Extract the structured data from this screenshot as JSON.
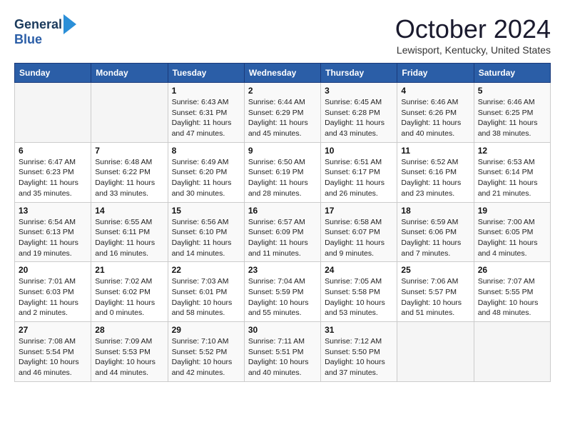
{
  "header": {
    "logo_line1": "General",
    "logo_line2": "Blue",
    "month_title": "October 2024",
    "location": "Lewisport, Kentucky, United States"
  },
  "days_of_week": [
    "Sunday",
    "Monday",
    "Tuesday",
    "Wednesday",
    "Thursday",
    "Friday",
    "Saturday"
  ],
  "weeks": [
    [
      {
        "num": "",
        "info": ""
      },
      {
        "num": "",
        "info": ""
      },
      {
        "num": "1",
        "info": "Sunrise: 6:43 AM\nSunset: 6:31 PM\nDaylight: 11 hours and 47 minutes."
      },
      {
        "num": "2",
        "info": "Sunrise: 6:44 AM\nSunset: 6:29 PM\nDaylight: 11 hours and 45 minutes."
      },
      {
        "num": "3",
        "info": "Sunrise: 6:45 AM\nSunset: 6:28 PM\nDaylight: 11 hours and 43 minutes."
      },
      {
        "num": "4",
        "info": "Sunrise: 6:46 AM\nSunset: 6:26 PM\nDaylight: 11 hours and 40 minutes."
      },
      {
        "num": "5",
        "info": "Sunrise: 6:46 AM\nSunset: 6:25 PM\nDaylight: 11 hours and 38 minutes."
      }
    ],
    [
      {
        "num": "6",
        "info": "Sunrise: 6:47 AM\nSunset: 6:23 PM\nDaylight: 11 hours and 35 minutes."
      },
      {
        "num": "7",
        "info": "Sunrise: 6:48 AM\nSunset: 6:22 PM\nDaylight: 11 hours and 33 minutes."
      },
      {
        "num": "8",
        "info": "Sunrise: 6:49 AM\nSunset: 6:20 PM\nDaylight: 11 hours and 30 minutes."
      },
      {
        "num": "9",
        "info": "Sunrise: 6:50 AM\nSunset: 6:19 PM\nDaylight: 11 hours and 28 minutes."
      },
      {
        "num": "10",
        "info": "Sunrise: 6:51 AM\nSunset: 6:17 PM\nDaylight: 11 hours and 26 minutes."
      },
      {
        "num": "11",
        "info": "Sunrise: 6:52 AM\nSunset: 6:16 PM\nDaylight: 11 hours and 23 minutes."
      },
      {
        "num": "12",
        "info": "Sunrise: 6:53 AM\nSunset: 6:14 PM\nDaylight: 11 hours and 21 minutes."
      }
    ],
    [
      {
        "num": "13",
        "info": "Sunrise: 6:54 AM\nSunset: 6:13 PM\nDaylight: 11 hours and 19 minutes."
      },
      {
        "num": "14",
        "info": "Sunrise: 6:55 AM\nSunset: 6:11 PM\nDaylight: 11 hours and 16 minutes."
      },
      {
        "num": "15",
        "info": "Sunrise: 6:56 AM\nSunset: 6:10 PM\nDaylight: 11 hours and 14 minutes."
      },
      {
        "num": "16",
        "info": "Sunrise: 6:57 AM\nSunset: 6:09 PM\nDaylight: 11 hours and 11 minutes."
      },
      {
        "num": "17",
        "info": "Sunrise: 6:58 AM\nSunset: 6:07 PM\nDaylight: 11 hours and 9 minutes."
      },
      {
        "num": "18",
        "info": "Sunrise: 6:59 AM\nSunset: 6:06 PM\nDaylight: 11 hours and 7 minutes."
      },
      {
        "num": "19",
        "info": "Sunrise: 7:00 AM\nSunset: 6:05 PM\nDaylight: 11 hours and 4 minutes."
      }
    ],
    [
      {
        "num": "20",
        "info": "Sunrise: 7:01 AM\nSunset: 6:03 PM\nDaylight: 11 hours and 2 minutes."
      },
      {
        "num": "21",
        "info": "Sunrise: 7:02 AM\nSunset: 6:02 PM\nDaylight: 11 hours and 0 minutes."
      },
      {
        "num": "22",
        "info": "Sunrise: 7:03 AM\nSunset: 6:01 PM\nDaylight: 10 hours and 58 minutes."
      },
      {
        "num": "23",
        "info": "Sunrise: 7:04 AM\nSunset: 5:59 PM\nDaylight: 10 hours and 55 minutes."
      },
      {
        "num": "24",
        "info": "Sunrise: 7:05 AM\nSunset: 5:58 PM\nDaylight: 10 hours and 53 minutes."
      },
      {
        "num": "25",
        "info": "Sunrise: 7:06 AM\nSunset: 5:57 PM\nDaylight: 10 hours and 51 minutes."
      },
      {
        "num": "26",
        "info": "Sunrise: 7:07 AM\nSunset: 5:55 PM\nDaylight: 10 hours and 48 minutes."
      }
    ],
    [
      {
        "num": "27",
        "info": "Sunrise: 7:08 AM\nSunset: 5:54 PM\nDaylight: 10 hours and 46 minutes."
      },
      {
        "num": "28",
        "info": "Sunrise: 7:09 AM\nSunset: 5:53 PM\nDaylight: 10 hours and 44 minutes."
      },
      {
        "num": "29",
        "info": "Sunrise: 7:10 AM\nSunset: 5:52 PM\nDaylight: 10 hours and 42 minutes."
      },
      {
        "num": "30",
        "info": "Sunrise: 7:11 AM\nSunset: 5:51 PM\nDaylight: 10 hours and 40 minutes."
      },
      {
        "num": "31",
        "info": "Sunrise: 7:12 AM\nSunset: 5:50 PM\nDaylight: 10 hours and 37 minutes."
      },
      {
        "num": "",
        "info": ""
      },
      {
        "num": "",
        "info": ""
      }
    ]
  ]
}
